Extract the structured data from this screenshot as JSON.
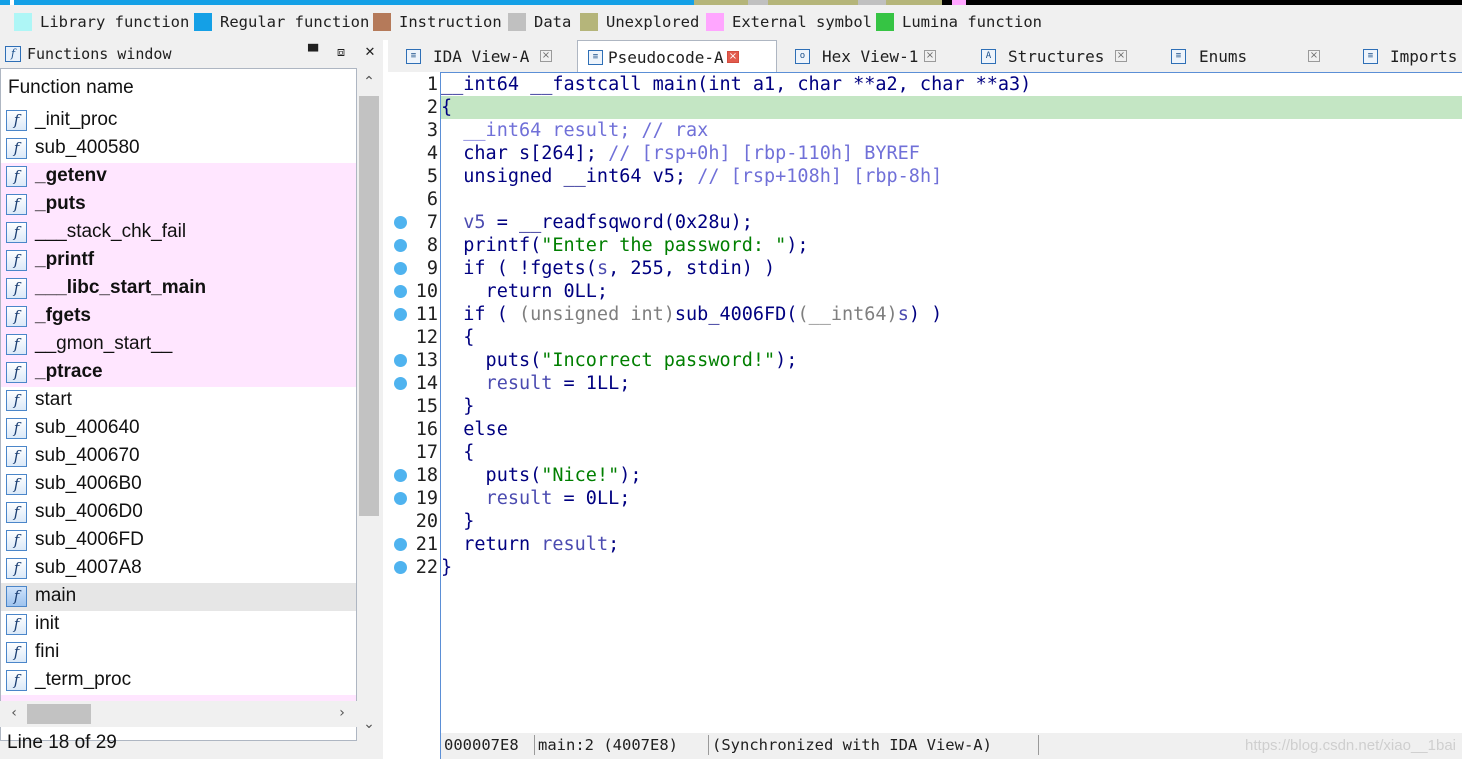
{
  "legend": [
    {
      "label": "Library function",
      "color": "#aef6f6"
    },
    {
      "label": "Regular function",
      "color": "#14a0e6"
    },
    {
      "label": "Instruction",
      "color": "#b57a5a"
    },
    {
      "label": "Data",
      "color": "#c0c0c0"
    },
    {
      "label": "Unexplored",
      "color": "#b5b57a"
    },
    {
      "label": "External symbol",
      "color": "#ffa6ff"
    },
    {
      "label": "Lumina function",
      "color": "#36c444"
    }
  ],
  "functions_window": {
    "title": "Functions window",
    "column_header": "Function name",
    "status": "Line 18 of 29",
    "items": [
      {
        "name": "_init_proc",
        "kind": "regular"
      },
      {
        "name": "sub_400580",
        "kind": "regular"
      },
      {
        "name": "_getenv",
        "kind": "external"
      },
      {
        "name": "_puts",
        "kind": "external"
      },
      {
        "name": "___stack_chk_fail",
        "kind": "external-plain"
      },
      {
        "name": "_printf",
        "kind": "external"
      },
      {
        "name": "___libc_start_main",
        "kind": "external"
      },
      {
        "name": "_fgets",
        "kind": "external"
      },
      {
        "name": "__gmon_start__",
        "kind": "external-plain"
      },
      {
        "name": "_ptrace",
        "kind": "external"
      },
      {
        "name": "start",
        "kind": "regular"
      },
      {
        "name": "sub_400640",
        "kind": "regular"
      },
      {
        "name": "sub_400670",
        "kind": "regular"
      },
      {
        "name": "sub_4006B0",
        "kind": "regular"
      },
      {
        "name": "sub_4006D0",
        "kind": "regular"
      },
      {
        "name": "sub_4006FD",
        "kind": "regular"
      },
      {
        "name": "sub_4007A8",
        "kind": "regular"
      },
      {
        "name": "main",
        "kind": "selected"
      },
      {
        "name": "init",
        "kind": "regular"
      },
      {
        "name": "fini",
        "kind": "regular"
      },
      {
        "name": "_term_proc",
        "kind": "regular"
      }
    ]
  },
  "tabs": [
    {
      "label": "IDA View-A",
      "icon": "ida-view-icon",
      "active": false
    },
    {
      "label": "Pseudocode-A",
      "icon": "pseudocode-icon",
      "active": true
    },
    {
      "label": "Hex View-1",
      "icon": "hex-view-icon",
      "active": false
    },
    {
      "label": "Structures",
      "icon": "structures-icon",
      "active": false
    },
    {
      "label": "Enums",
      "icon": "enums-icon",
      "active": false
    },
    {
      "label": "Imports",
      "icon": "imports-icon",
      "active": false
    }
  ],
  "code": {
    "highlight_line": 2,
    "lines": [
      {
        "n": "1",
        "bp": false,
        "tokens": [
          [
            "k",
            "__int64 __fastcall main(int a1, char **a2, char **a3)"
          ]
        ]
      },
      {
        "n": "2",
        "bp": false,
        "tokens": [
          [
            "k",
            "{"
          ]
        ]
      },
      {
        "n": "3",
        "bp": false,
        "tokens": [
          [
            "k",
            "  "
          ],
          [
            "c",
            "__int64 result; // rax"
          ]
        ]
      },
      {
        "n": "4",
        "bp": false,
        "tokens": [
          [
            "k",
            "  char s[264]; "
          ],
          [
            "c",
            "// [rsp+0h] [rbp-110h] BYREF"
          ]
        ]
      },
      {
        "n": "5",
        "bp": false,
        "tokens": [
          [
            "k",
            "  unsigned __int64 v5; "
          ],
          [
            "c",
            "// [rsp+108h] [rbp-8h]"
          ]
        ]
      },
      {
        "n": "6",
        "bp": false,
        "tokens": [
          [
            "k",
            ""
          ]
        ]
      },
      {
        "n": "7",
        "bp": true,
        "tokens": [
          [
            "k",
            "  "
          ],
          [
            "v",
            "v5"
          ],
          [
            "k",
            " = __readfsqword(0x28u);"
          ]
        ]
      },
      {
        "n": "8",
        "bp": true,
        "tokens": [
          [
            "k",
            "  printf("
          ],
          [
            "s",
            "\"Enter the password: \""
          ],
          [
            "k",
            ");"
          ]
        ]
      },
      {
        "n": "9",
        "bp": true,
        "tokens": [
          [
            "k",
            "  if ( !fgets("
          ],
          [
            "v",
            "s"
          ],
          [
            "k",
            ", 255, stdin) )"
          ]
        ]
      },
      {
        "n": "10",
        "bp": true,
        "tokens": [
          [
            "k",
            "    return 0LL;"
          ]
        ]
      },
      {
        "n": "11",
        "bp": true,
        "tokens": [
          [
            "k",
            "  if ( "
          ],
          [
            "g",
            "(unsigned int)"
          ],
          [
            "k",
            "sub_4006FD("
          ],
          [
            "g",
            "(__int64)"
          ],
          [
            "v",
            "s"
          ],
          [
            "k",
            ") )"
          ]
        ]
      },
      {
        "n": "12",
        "bp": false,
        "tokens": [
          [
            "k",
            "  {"
          ]
        ]
      },
      {
        "n": "13",
        "bp": true,
        "tokens": [
          [
            "k",
            "    puts("
          ],
          [
            "s",
            "\"Incorrect password!\""
          ],
          [
            "k",
            ");"
          ]
        ]
      },
      {
        "n": "14",
        "bp": true,
        "tokens": [
          [
            "k",
            "    "
          ],
          [
            "v",
            "result"
          ],
          [
            "k",
            " = 1LL;"
          ]
        ]
      },
      {
        "n": "15",
        "bp": false,
        "tokens": [
          [
            "k",
            "  }"
          ]
        ]
      },
      {
        "n": "16",
        "bp": false,
        "tokens": [
          [
            "k",
            "  else"
          ]
        ]
      },
      {
        "n": "17",
        "bp": false,
        "tokens": [
          [
            "k",
            "  {"
          ]
        ]
      },
      {
        "n": "18",
        "bp": true,
        "tokens": [
          [
            "k",
            "    puts("
          ],
          [
            "s",
            "\"Nice!\""
          ],
          [
            "k",
            ");"
          ]
        ]
      },
      {
        "n": "19",
        "bp": true,
        "tokens": [
          [
            "k",
            "    "
          ],
          [
            "v",
            "result"
          ],
          [
            "k",
            " = 0LL;"
          ]
        ]
      },
      {
        "n": "20",
        "bp": false,
        "tokens": [
          [
            "k",
            "  }"
          ]
        ]
      },
      {
        "n": "21",
        "bp": true,
        "tokens": [
          [
            "k",
            "  return "
          ],
          [
            "v",
            "result"
          ],
          [
            "k",
            ";"
          ]
        ]
      },
      {
        "n": "22",
        "bp": true,
        "tokens": [
          [
            "k",
            "}"
          ]
        ]
      }
    ]
  },
  "statusbar": {
    "address": "000007E8",
    "location": "main:2 (4007E8)",
    "sync": "(Synchronized with IDA View-A)",
    "watermark": "https://blog.csdn.net/xiao__1bai"
  }
}
